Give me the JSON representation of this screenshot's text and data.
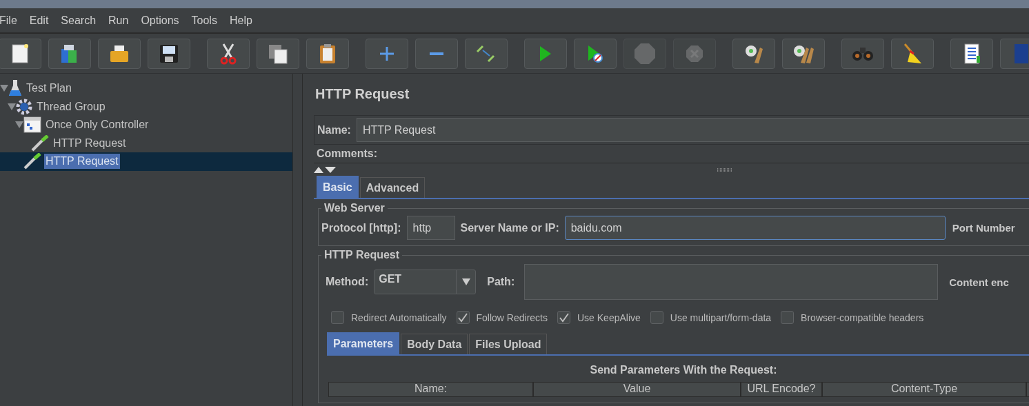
{
  "menu": [
    "File",
    "Edit",
    "Search",
    "Run",
    "Options",
    "Tools",
    "Help"
  ],
  "toolbar": [
    [
      {
        "kind": "new",
        "disabled": false
      },
      {
        "kind": "templates",
        "disabled": false
      },
      {
        "kind": "open",
        "disabled": false
      },
      {
        "kind": "save",
        "disabled": false
      }
    ],
    [
      {
        "kind": "cut",
        "disabled": false
      },
      {
        "kind": "copy",
        "disabled": false
      },
      {
        "kind": "paste",
        "disabled": false
      }
    ],
    [
      {
        "kind": "expand",
        "disabled": false
      },
      {
        "kind": "collapse",
        "disabled": false
      },
      {
        "kind": "toggle",
        "disabled": false
      }
    ],
    [
      {
        "kind": "start",
        "disabled": false
      },
      {
        "kind": "start-no-pause",
        "disabled": false
      },
      {
        "kind": "stop",
        "disabled": true
      },
      {
        "kind": "shutdown",
        "disabled": true
      }
    ],
    [
      {
        "kind": "clear",
        "disabled": false
      },
      {
        "kind": "clear-all",
        "disabled": false
      }
    ],
    [
      {
        "kind": "search",
        "disabled": false
      },
      {
        "kind": "reset-search",
        "disabled": false
      }
    ],
    [
      {
        "kind": "function-helper",
        "disabled": false
      },
      {
        "kind": "help",
        "disabled": false
      }
    ]
  ],
  "tree": [
    {
      "label": "Test Plan",
      "kind": "plan",
      "expanded": true,
      "selected": false,
      "children": [
        {
          "label": "Thread Group",
          "kind": "threads",
          "expanded": true,
          "selected": false,
          "children": [
            {
              "label": "Once Only Controller",
              "kind": "controller",
              "expanded": true,
              "selected": false,
              "children": [
                {
                  "label": "HTTP Request",
                  "kind": "sampler",
                  "selected": false
                }
              ]
            },
            {
              "label": "HTTP Request",
              "kind": "sampler",
              "selected": true
            }
          ]
        }
      ]
    }
  ],
  "editor": {
    "title": "HTTP Request",
    "name_label": "Name:",
    "name_value": "HTTP Request",
    "comments_label": "Comments:",
    "tabs": [
      {
        "label": "Basic",
        "selected": true
      },
      {
        "label": "Advanced",
        "selected": false
      }
    ],
    "web_server": {
      "legend": "Web Server",
      "protocol_label": "Protocol [http]:",
      "protocol_value": "http",
      "server_label": "Server Name or IP:",
      "server_value": "baidu.com",
      "port_label": "Port Number"
    },
    "http_request": {
      "legend": "HTTP Request",
      "method_label": "Method:",
      "method_value": "GET",
      "path_label": "Path:",
      "content_label": "Content enc",
      "options": [
        {
          "label": "Redirect Automatically",
          "checked": false
        },
        {
          "label": "Follow Redirects",
          "checked": true
        },
        {
          "label": "Use KeepAlive",
          "checked": true
        },
        {
          "label": "Use multipart/form-data",
          "checked": false
        },
        {
          "label": "Browser-compatible headers",
          "checked": false
        }
      ]
    },
    "sub_tabs": [
      {
        "label": "Parameters",
        "selected": true
      },
      {
        "label": "Body Data",
        "selected": false
      },
      {
        "label": "Files Upload",
        "selected": false
      }
    ],
    "table_title": "Send Parameters With the Request:",
    "columns": [
      "Name:",
      "Value",
      "URL Encode?",
      "Content-Type"
    ]
  }
}
